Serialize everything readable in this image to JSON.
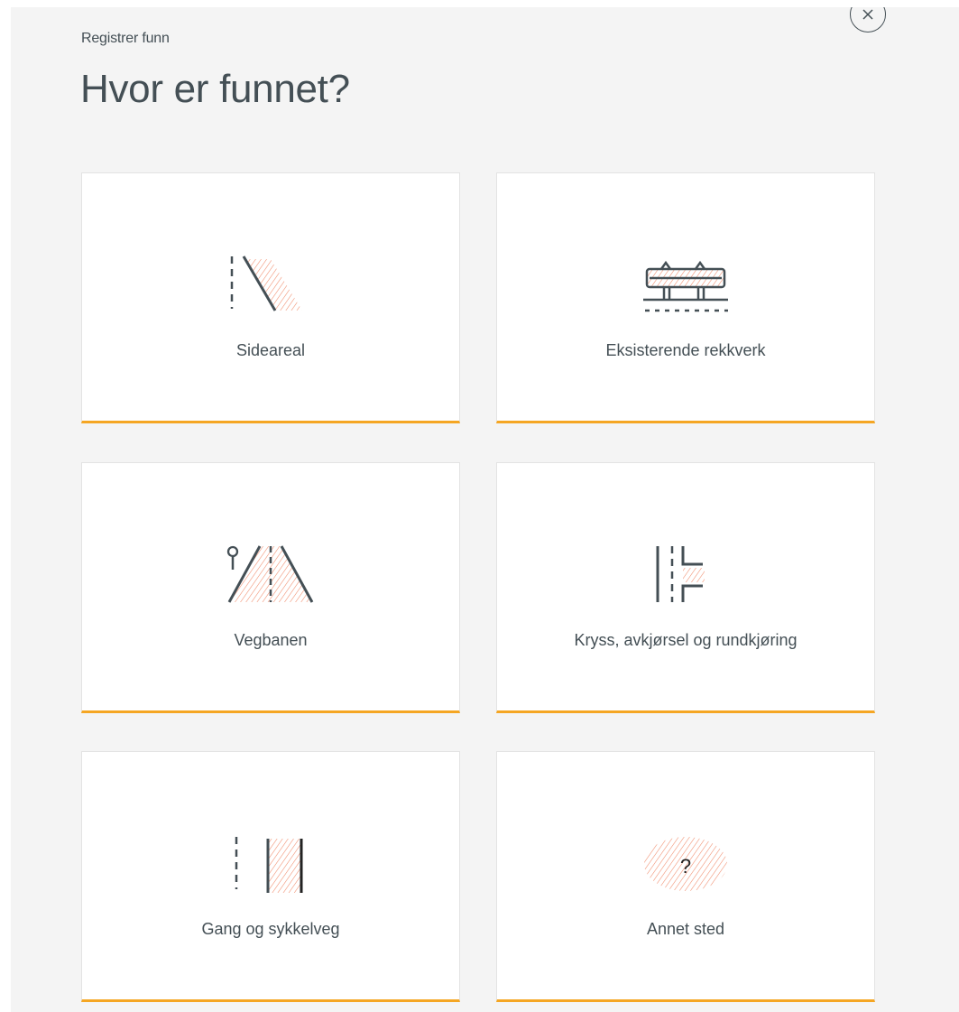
{
  "header": {
    "eyebrow": "Registrer funn",
    "title": "Hvor er funnet?"
  },
  "options": [
    {
      "label": "Sideareal",
      "icon": "sideareal-icon"
    },
    {
      "label": "Eksisterende rekkverk",
      "icon": "guardrail-icon"
    },
    {
      "label": "Vegbanen",
      "icon": "roadway-icon"
    },
    {
      "label": "Kryss, avkjørsel og rundkjøring",
      "icon": "intersection-icon"
    },
    {
      "label": "Gang og sykkelveg",
      "icon": "bike-path-icon"
    },
    {
      "label": "Annet sted",
      "icon": "other-place-icon"
    }
  ],
  "colors": {
    "accent": "#f5a623",
    "hatch": "#f08a6a",
    "text": "#444f55",
    "background": "#f4f4f4"
  }
}
